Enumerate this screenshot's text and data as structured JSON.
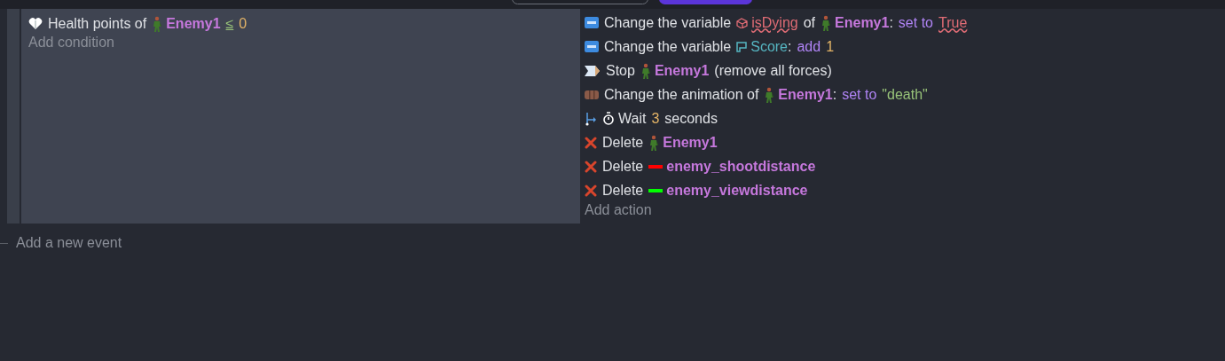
{
  "event": {
    "conditions": [
      {
        "kind": "health",
        "segments": [
          {
            "kind": "text",
            "text": "Health points of"
          },
          {
            "kind": "object",
            "text": "Enemy1"
          },
          {
            "kind": "operator",
            "text": "≤"
          },
          {
            "kind": "number",
            "text": "0"
          }
        ]
      }
    ],
    "add_condition": "Add condition",
    "actions": [
      {
        "kind": "variable",
        "segments": [
          {
            "kind": "text",
            "text": "Change the variable"
          },
          {
            "kind": "error-var",
            "text": "isDying"
          },
          {
            "kind": "text",
            "text": "of"
          },
          {
            "kind": "object",
            "text": "Enemy1"
          },
          {
            "kind": "colon",
            "text": ":"
          },
          {
            "kind": "param",
            "text": "set to"
          },
          {
            "kind": "error-value",
            "text": "True"
          }
        ]
      },
      {
        "kind": "variable",
        "segments": [
          {
            "kind": "text",
            "text": "Change the variable"
          },
          {
            "kind": "var",
            "text": "Score"
          },
          {
            "kind": "colon",
            "text": ":"
          },
          {
            "kind": "param",
            "text": "add"
          },
          {
            "kind": "number",
            "text": "1"
          }
        ]
      },
      {
        "kind": "stop",
        "segments": [
          {
            "kind": "text",
            "text": "Stop"
          },
          {
            "kind": "object",
            "text": "Enemy1"
          },
          {
            "kind": "text",
            "text": "(remove all forces)"
          }
        ]
      },
      {
        "kind": "animation",
        "segments": [
          {
            "kind": "text",
            "text": "Change the animation of"
          },
          {
            "kind": "object",
            "text": "Enemy1"
          },
          {
            "kind": "colon",
            "text": ":"
          },
          {
            "kind": "param",
            "text": "set to"
          },
          {
            "kind": "string",
            "text": "\"death\""
          }
        ]
      },
      {
        "kind": "wait",
        "segments": [
          {
            "kind": "timer",
            "text": "Wait"
          },
          {
            "kind": "number",
            "text": "3"
          },
          {
            "kind": "text",
            "text": "seconds"
          }
        ]
      },
      {
        "kind": "delete",
        "segments": [
          {
            "kind": "text",
            "text": "Delete"
          },
          {
            "kind": "object",
            "text": "Enemy1"
          }
        ]
      },
      {
        "kind": "delete",
        "segments": [
          {
            "kind": "text",
            "text": "Delete"
          },
          {
            "kind": "line-object",
            "color": "#ff0000",
            "text": "enemy_shootdistance"
          }
        ]
      },
      {
        "kind": "delete",
        "segments": [
          {
            "kind": "text",
            "text": "Delete"
          },
          {
            "kind": "line-object",
            "color": "#00ff00",
            "text": "enemy_viewdistance"
          }
        ]
      }
    ],
    "add_action": "Add action"
  },
  "add_event": "Add a new event"
}
